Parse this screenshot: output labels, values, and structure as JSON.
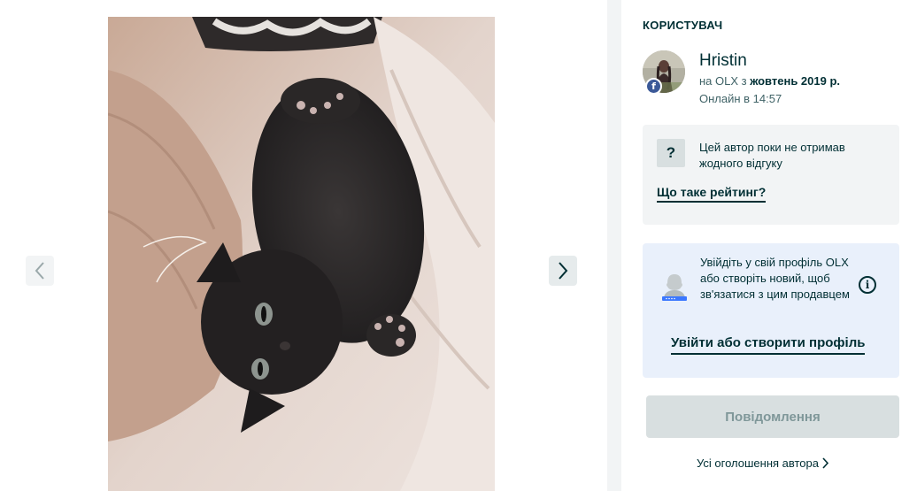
{
  "gallery": {
    "image_alt": "black kitten lying on a blanket",
    "prev_icon": "chevron-left-icon",
    "next_icon": "chevron-right-icon"
  },
  "seller": {
    "section_title": "КОРИСТУВАЧ",
    "name": "Hristin",
    "member_prefix": "на OLX з ",
    "member_since": "жовтень 2019 р.",
    "online_status": "Онлайн в 14:57",
    "facebook_badge": "f"
  },
  "rating": {
    "icon_label": "?",
    "text": "Цей автор поки не отримав жодного відгуку",
    "link": "Що таке рейтинг?"
  },
  "login": {
    "text": "Увійдіть у свій профіль OLX або створіть новий, щоб зв'язатися з цим продавцем",
    "info_icon": "i",
    "link": "Увійти або створити профіль"
  },
  "actions": {
    "message_button": "Повідомлення",
    "all_ads_link": "Усі оголошення автора",
    "all_ads_icon": "chevron-right-icon"
  },
  "colors": {
    "brand_dark": "#002f34",
    "muted_text": "#406367",
    "panel_bg": "#f2f4f5",
    "login_bg": "#e9f0fb",
    "button_disabled_bg": "#d8dfe0",
    "button_disabled_text": "#7f9799",
    "facebook": "#3b5998"
  }
}
